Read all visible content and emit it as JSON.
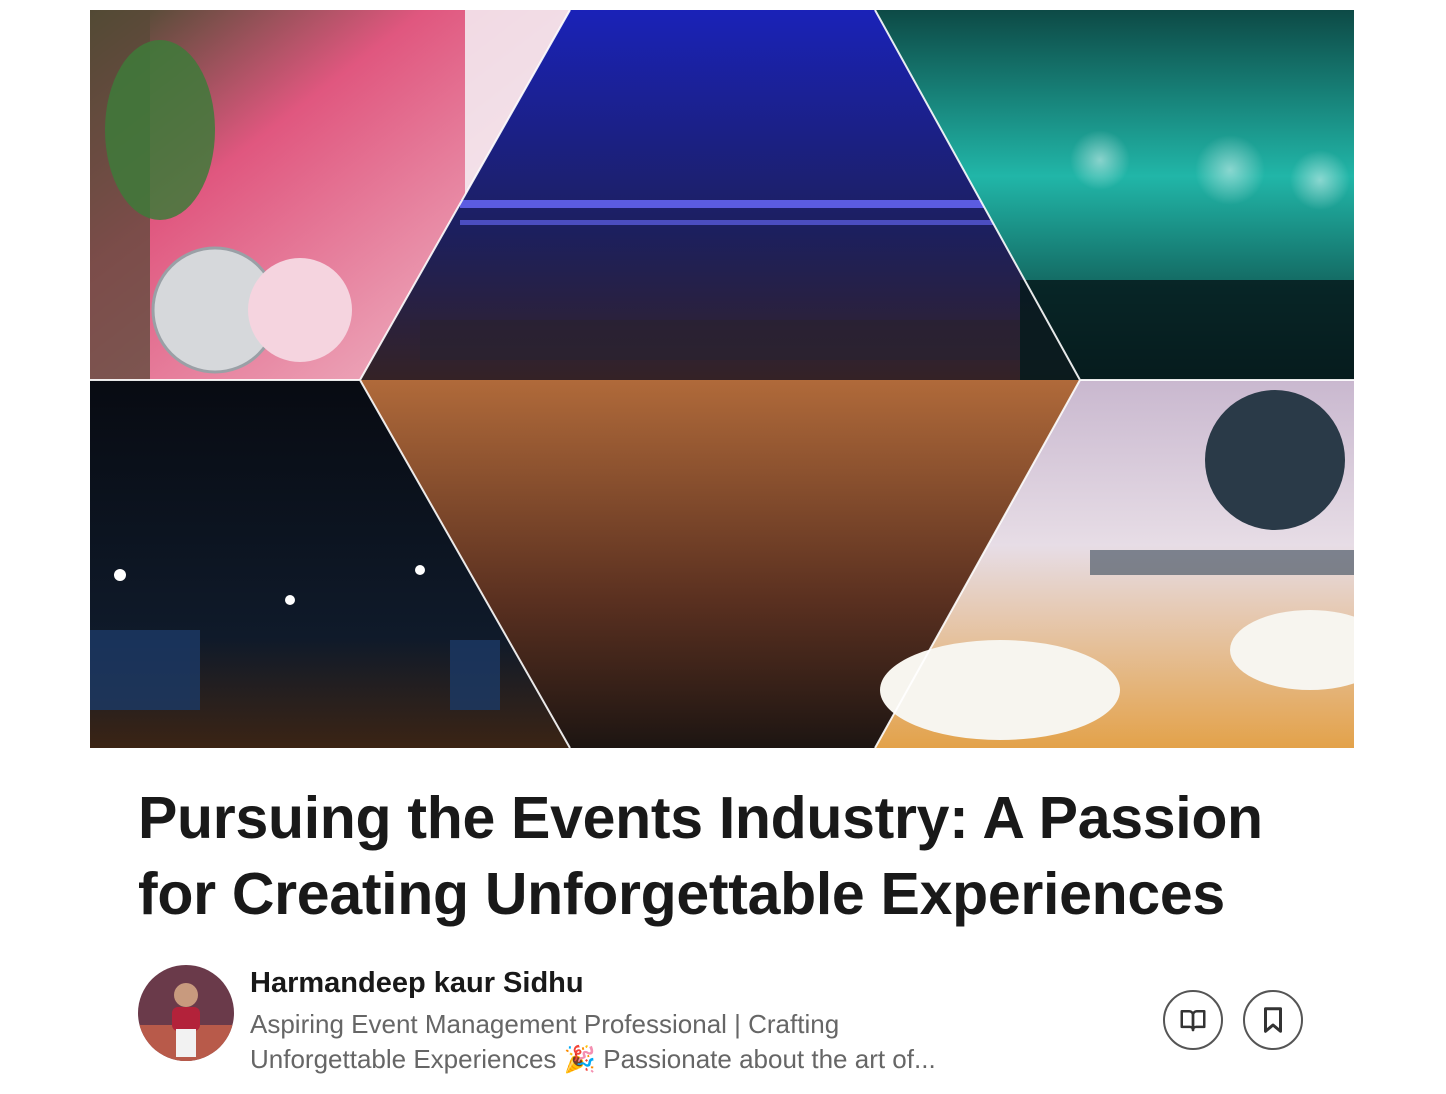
{
  "article": {
    "cover_image_alt": "Collage of event venues: floral decor, conference hall audience, concert crowd, ballroom, and restaurant dining room",
    "title": "Pursuing the Events Industry: A Passion for Creating Unforgettable Experiences"
  },
  "author": {
    "name": "Harmandeep kaur Sidhu",
    "headline_line1": "Aspiring Event Management Professional | Crafting",
    "headline_line2": "Unforgettable Experiences 🎉 Passionate about the art of..."
  },
  "actions": {
    "read_icon": "open-book-icon",
    "save_icon": "bookmark-icon"
  },
  "colors": {
    "text_primary": "#191919",
    "text_secondary": "#666666",
    "button_border": "#555555"
  }
}
